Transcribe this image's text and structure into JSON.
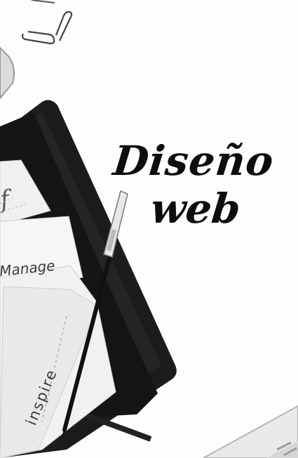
{
  "headline": {
    "line1": "Diseño",
    "line2": "web"
  },
  "notes": {
    "manage": "Manage",
    "inspire": "inspire"
  },
  "colors": {
    "ink": "#0d0d0d",
    "notebook": "#1c1c1c",
    "paper": "#f3f3f3",
    "background": "#fdfdfd"
  },
  "icons": [
    "paperclip-icon",
    "paperclip-icon",
    "phone",
    "notebook",
    "pen",
    "keyboard"
  ]
}
